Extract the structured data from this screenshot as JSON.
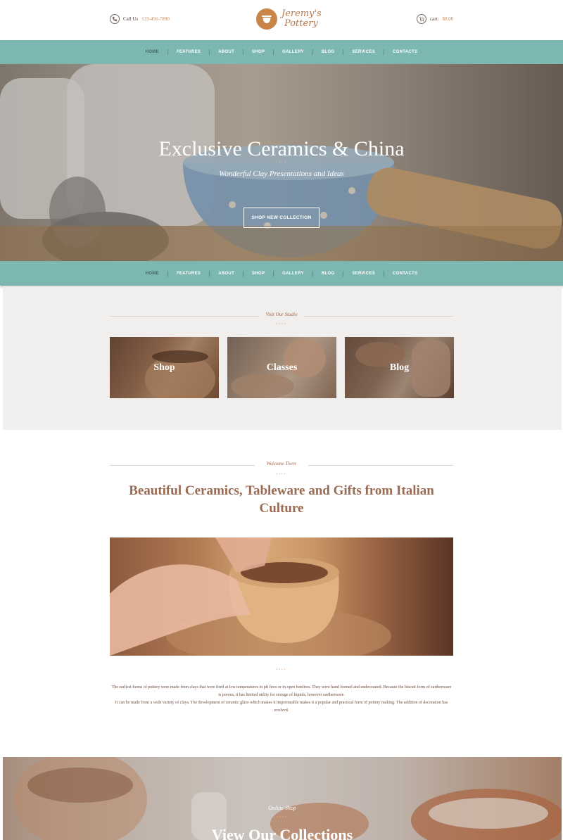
{
  "header": {
    "call_prefix": "Call Us",
    "phone": "123-456-7890",
    "logo_line1": "Jeremy's",
    "logo_line2": "Pottery",
    "cart_label": "cart:",
    "cart_amount": "$0.00"
  },
  "nav": {
    "items": [
      "HOME",
      "FEATURES",
      "ABOUT",
      "SHOP",
      "GALLERY",
      "BLOG",
      "SERVICES",
      "CONTACTS"
    ]
  },
  "hero": {
    "title": "Exclusive Ceramics & China",
    "dots": "••••",
    "subtitle": "Wonderful Clay Presentations and Ideas",
    "button": "SHOP NEW COLLECTION"
  },
  "studio": {
    "label": "Visit Our Studio",
    "dots": "••••",
    "tiles": [
      "Shop",
      "Classes",
      "Blog"
    ]
  },
  "welcome": {
    "label": "Welcome There",
    "dots": "••••",
    "title": "Beautiful Ceramics, Tableware and Gifts from Italian Culture",
    "dots2": "••••",
    "para1": "The earliest forms of pottery were made from clays that were fired at low temperatures in pit fires or in open bonfires. They were hand formed and undecorated. Because the biscuit form of earthenware is porous, it has limited utility for storage of liquids, however earthenware.",
    "para2": "It can be made from a wide variety of clays. The development of ceramic glaze which makes it impermeable makes it a popular and practical form of pottery making. The addition of decoration has evolved."
  },
  "collection": {
    "label": "Online Shop",
    "dots": "••••",
    "title": "View Our Collections"
  },
  "colors": {
    "accent": "#c98447",
    "nav_teal": "#7db7b2",
    "heading_brown": "#9a6a52"
  }
}
